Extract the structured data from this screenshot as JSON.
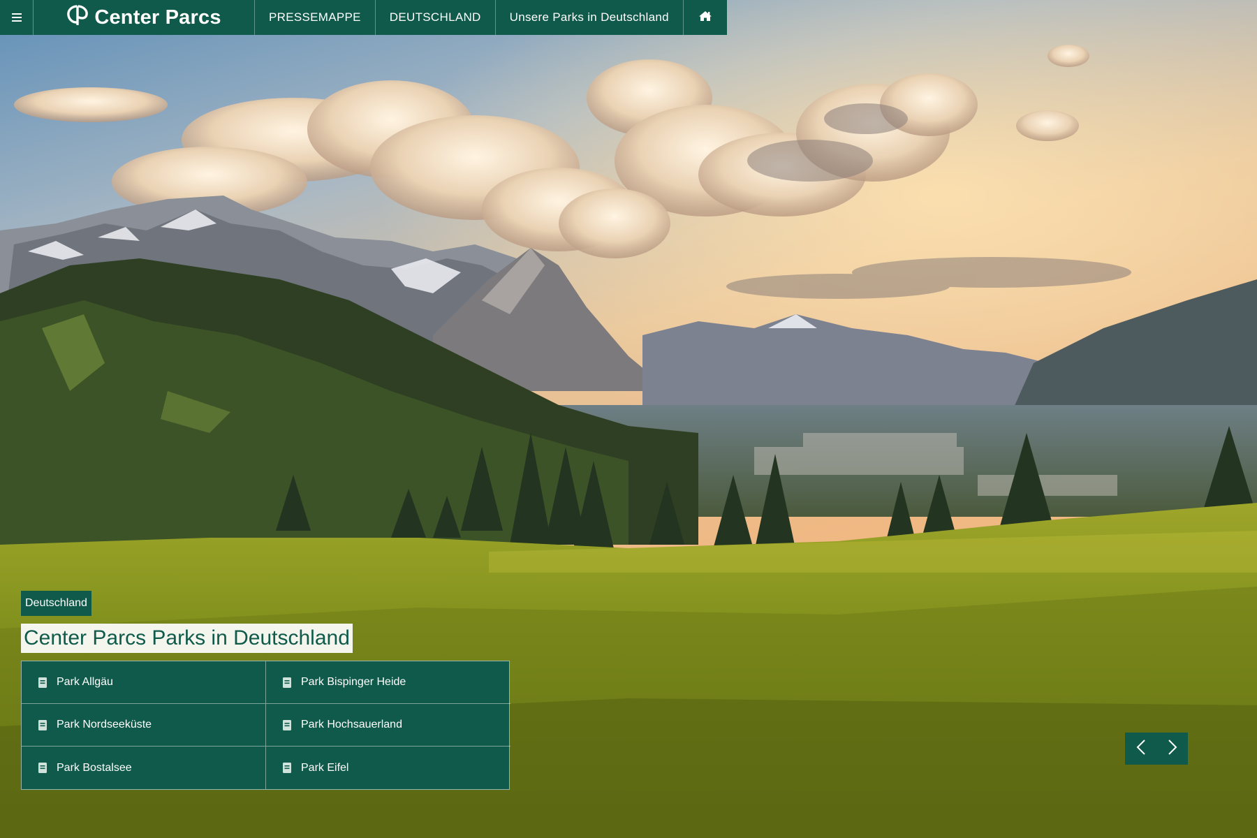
{
  "brand": {
    "name": "Center Parcs",
    "color_primary": "#0f5a4a",
    "color_text_light": "#ffffff"
  },
  "topbar": {
    "menu_icon": "hamburger-menu-icon",
    "nav_items": [
      {
        "label": "PRESSEMAPPE"
      },
      {
        "label": "DEUTSCHLAND"
      },
      {
        "label": "Unsere Parks in Deutschland"
      }
    ],
    "home_icon": "home-icon"
  },
  "hero": {
    "tag": "Deutschland",
    "title": "Center Parcs Parks in Deutschland"
  },
  "parks": [
    {
      "label": "Park Allgäu"
    },
    {
      "label": "Park Bispinger Heide"
    },
    {
      "label": "Park Nordseeküste"
    },
    {
      "label": "Park Hochsauerland"
    },
    {
      "label": "Park Bostalsee"
    },
    {
      "label": "Park Eifel"
    }
  ],
  "carousel": {
    "prev_icon": "chevron-left-icon",
    "next_icon": "chevron-right-icon"
  }
}
